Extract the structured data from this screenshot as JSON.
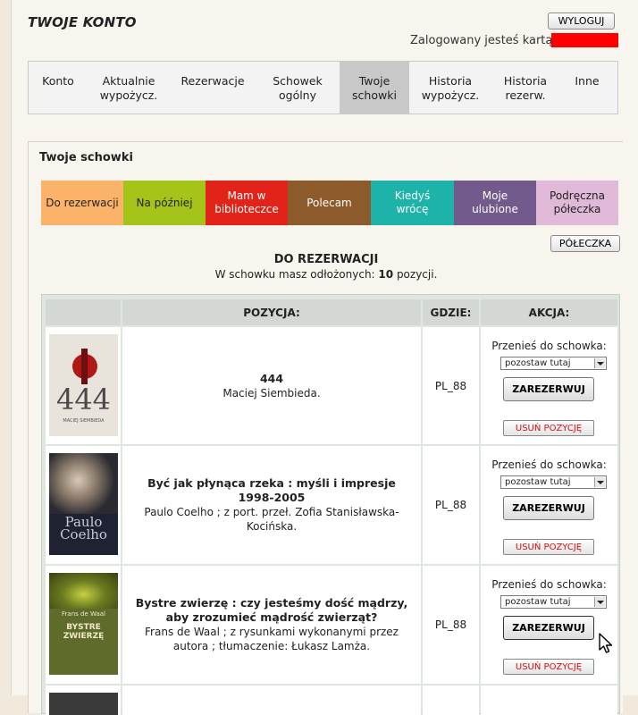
{
  "header": {
    "title": "TWOJE KONTO",
    "logout_label": "WYLOGUJ",
    "logged_in_text": "Zalogowany jesteś kartą:"
  },
  "nav": {
    "items": [
      {
        "line1": "Konto",
        "line2": ""
      },
      {
        "line1": "Aktualnie",
        "line2": "wypożycz."
      },
      {
        "line1": "Rezerwacje",
        "line2": ""
      },
      {
        "line1": "Schowek",
        "line2": "ogólny"
      },
      {
        "line1": "Twoje",
        "line2": "schowki"
      },
      {
        "line1": "Historia",
        "line2": "wypożycz."
      },
      {
        "line1": "Historia",
        "line2": "rezerw."
      },
      {
        "line1": "Inne",
        "line2": ""
      }
    ]
  },
  "panel": {
    "title": "Twoje schowki",
    "tabs": [
      {
        "line1": "Do rezerwacji",
        "line2": "",
        "color": "#fbb36a",
        "text_color": "#222222"
      },
      {
        "line1": "Na później",
        "line2": "",
        "color": "#a4c41a",
        "text_color": "#222222"
      },
      {
        "line1": "Mam w",
        "line2": "biblioteczce",
        "color": "#e2231a",
        "text_color": "#ffffff"
      },
      {
        "line1": "Polecam",
        "line2": "",
        "color": "#8d5a2b",
        "text_color": "#ffffff"
      },
      {
        "line1": "Kiedyś",
        "line2": "wrócę",
        "color": "#1eb3a8",
        "text_color": "#ffffff"
      },
      {
        "line1": "Moje",
        "line2": "ulubione",
        "color": "#735a8c",
        "text_color": "#ffffff"
      },
      {
        "line1": "Podręczna",
        "line2": "półeczka",
        "color": "#e0b8d8",
        "text_color": "#222222"
      }
    ],
    "shelf_button": "PÓŁECZKA",
    "section_title": "DO REZERWACJI",
    "count_prefix": "W schowku masz odłożonych: ",
    "count_value": "10",
    "count_suffix": " pozycji."
  },
  "table": {
    "headers": {
      "position": "POZYCJA:",
      "where": "GDZIE:",
      "action": "AKCJA:"
    },
    "move_label": "Przenieś do schowka:",
    "select_value": "pozostaw tutaj",
    "reserve_label": "ZAREZERWUJ",
    "remove_label": "USUŃ POZYCJĘ",
    "rows": [
      {
        "title": "444",
        "author": "Maciej Siembieda.",
        "author2": "",
        "where": "PL_88",
        "cover": {
          "bg": "#e8e4dc",
          "line1": "444",
          "line2": "MACIEJ SIEMBIEDA"
        }
      },
      {
        "title": "Być jak płynąca rzeka : myśli i impresje 1998-2005",
        "author": "Paulo Coelho ; z port. przeł. Zofia Stanisławska-",
        "author2": "Kocińska.",
        "where": "PL_88",
        "cover": {
          "bg": "#1f2233",
          "line1": "Paulo",
          "line2": "Coelho"
        }
      },
      {
        "title": "Bystre zwierzę : czy jesteśmy dość mądrzy, aby zrozumieć mądrość zwierząt?",
        "author": "Frans de Waal ; z rysunkami wykonanymi przez",
        "author2": "autora ; tłumaczenie: Łukasz Lamża.",
        "where": "PL_88",
        "cover": {
          "bg": "#5e6b2a",
          "line1": "Frans de Waal",
          "line2": "BYSTRE ZWIERZĘ"
        }
      }
    ]
  }
}
